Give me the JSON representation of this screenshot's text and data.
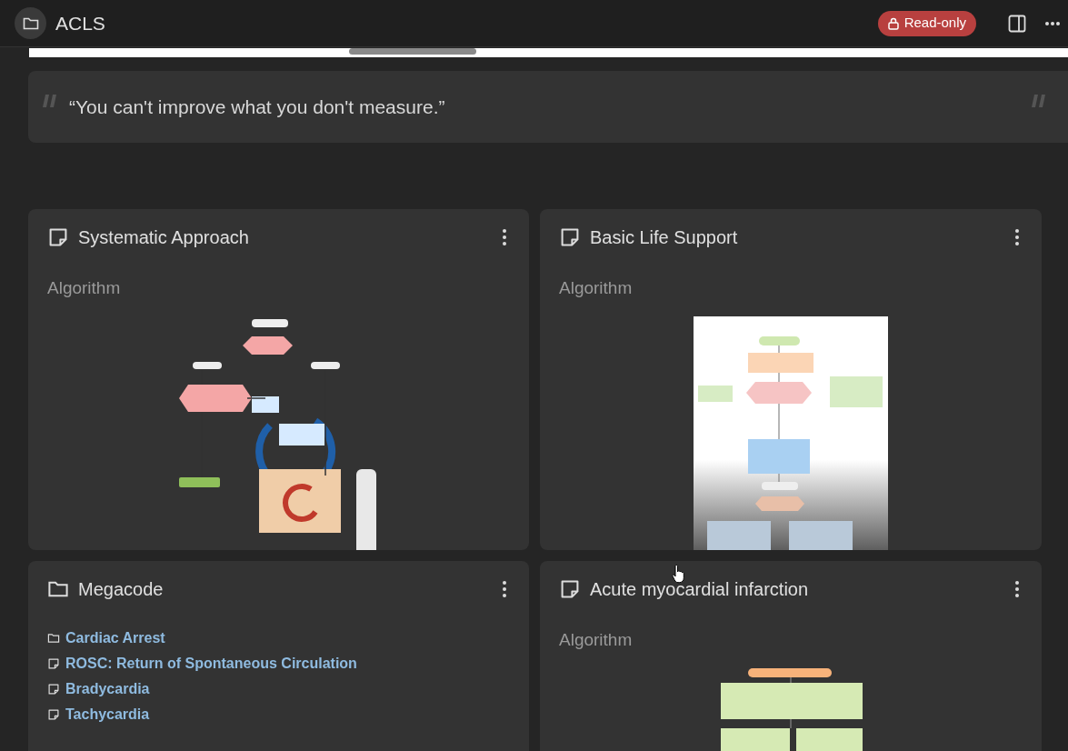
{
  "header": {
    "title": "ACLS",
    "badge": "Read-only"
  },
  "quote": "“You can't improve what you don't measure.”",
  "cards": [
    {
      "kind": "note",
      "title": "Systematic Approach",
      "subtitle": "Algorithm"
    },
    {
      "kind": "note",
      "title": "Basic Life Support",
      "subtitle": "Algorithm"
    },
    {
      "kind": "folder",
      "title": "Megacode",
      "items": [
        {
          "kind": "folder",
          "label": "Cardiac Arrest"
        },
        {
          "kind": "note",
          "label": "ROSC: Return of Spontaneous Circulation"
        },
        {
          "kind": "note",
          "label": "Bradycardia"
        },
        {
          "kind": "note",
          "label": "Tachycardia"
        }
      ]
    },
    {
      "kind": "note",
      "title": "Acute myocardial infarction",
      "subtitle": "Algorithm"
    }
  ]
}
